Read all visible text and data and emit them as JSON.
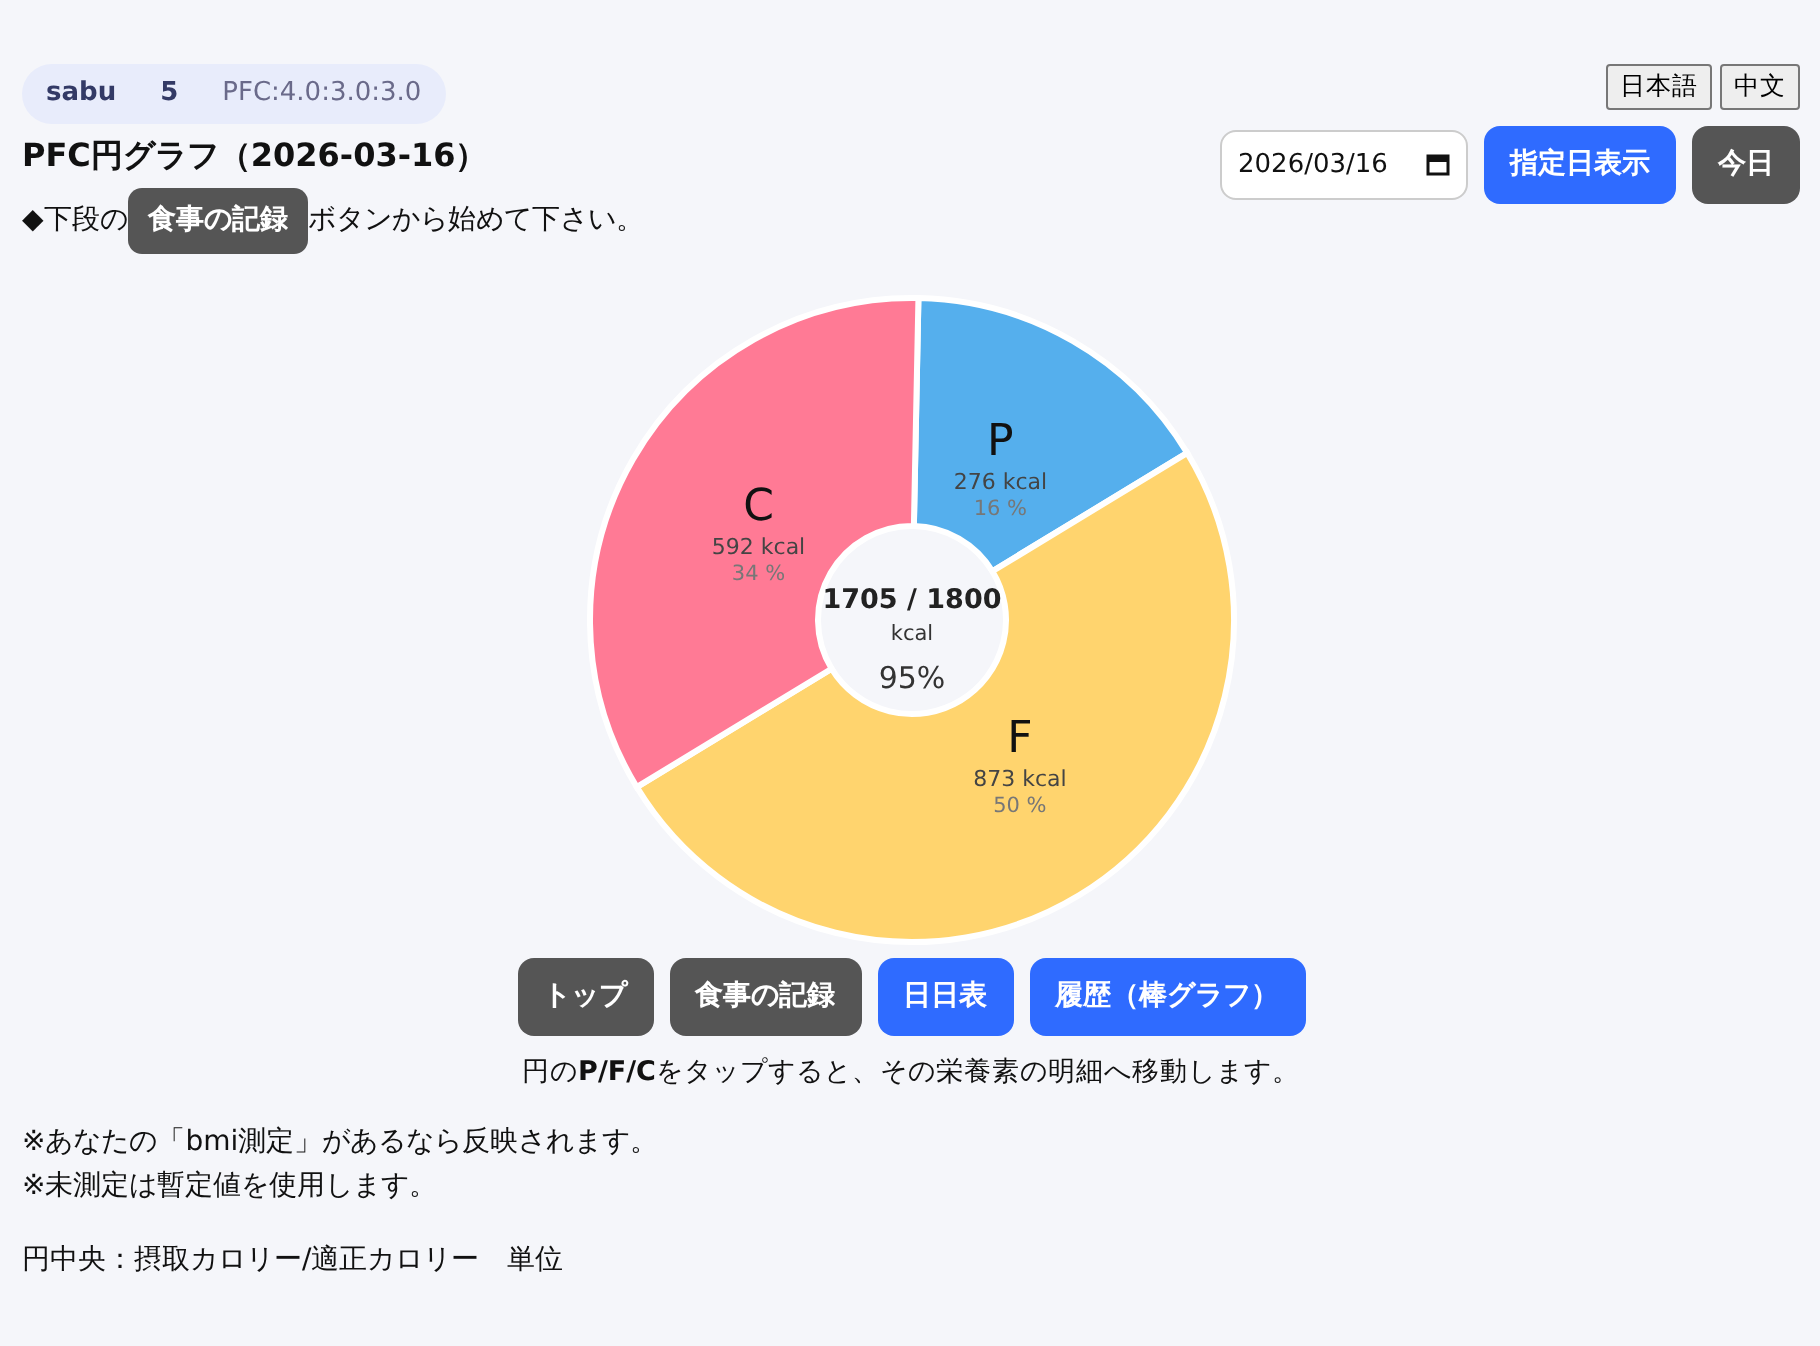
{
  "user_badge": {
    "name": "sabu",
    "level": "5",
    "pfc": "PFC:4.0:3.0:3.0"
  },
  "language_buttons": [
    "日本語",
    "中文"
  ],
  "title": "PFC円グラフ（2026-03-16）",
  "date_field": {
    "value": "2026/03/16"
  },
  "top_buttons": [
    {
      "label": "指定日表示",
      "kind": "primary"
    },
    {
      "label": "今日",
      "kind": "secondary"
    }
  ],
  "instruction": {
    "before": "◆下段の",
    "button": "食事の記録",
    "after": "ボタンから始めて下さい。"
  },
  "chart_data": {
    "type": "donut",
    "categories": [
      "P",
      "F",
      "C"
    ],
    "series": [
      {
        "values": [
          16,
          50,
          34
        ]
      }
    ]
  },
  "slice_labels": [
    {
      "kcal": "276 kcal",
      "percent": "16 %",
      "color": "#55afed"
    },
    {
      "kcal": "873 kcal",
      "percent": "50 %",
      "color": "#ffd46e"
    },
    {
      "kcal": "592 kcal",
      "percent": "34 %",
      "color": "#ff7a95"
    }
  ],
  "center": {
    "ratio": "1705 / 1800",
    "unit": "kcal",
    "percent": "95%"
  },
  "nav_buttons": [
    {
      "label": "トップ",
      "kind": "secondary"
    },
    {
      "label": "食事の記録",
      "kind": "secondary"
    },
    {
      "label": "日日表",
      "kind": "primary"
    },
    {
      "label": "履歴（棒グラフ）",
      "kind": "primary"
    }
  ],
  "tap_hint": "円の**P/F/C**をタップすると、その栄養素の明細へ移動します。",
  "notes": [
    "※あなたの「bmi測定」があるなら反映されます。",
    "※未測定は暫定値を使用します。"
  ],
  "legend": "円中央：摂取カロリー/適正カロリー　単位"
}
